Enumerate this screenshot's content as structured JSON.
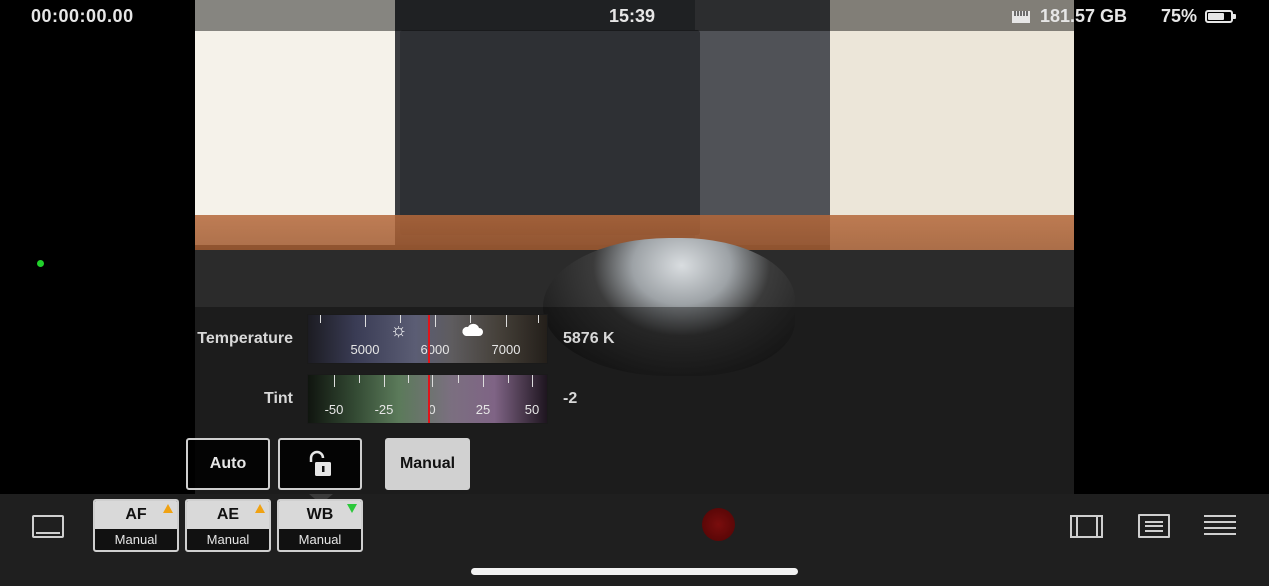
{
  "status_bar": {
    "timecode": "00:00:00.00",
    "clock": "15:39",
    "storage_icon": "sd-card-icon",
    "storage": "181.57 GB",
    "battery": "75%",
    "battery_level_fraction": 0.75
  },
  "preview": {
    "scene": "camera-live-view"
  },
  "white_balance": {
    "temperature_label": "Temperature",
    "temperature_ticks": [
      "5000",
      "6000",
      "7000"
    ],
    "temperature_value": "5876 K",
    "temperature_icons": [
      "sun-icon",
      "cloud-icon"
    ],
    "tint_label": "Tint",
    "tint_ticks": [
      "-50",
      "-25",
      "0",
      "25",
      "50"
    ],
    "tint_value": "-2",
    "buttons": {
      "auto": "Auto",
      "lock_icon": "unlock-icon",
      "manual": "Manual"
    },
    "selected_mode": "Manual"
  },
  "bottom_bar": {
    "pills": [
      {
        "title": "AF",
        "sub": "Manual",
        "flag": "warning",
        "flag_color": "#f0a212"
      },
      {
        "title": "AE",
        "sub": "Manual",
        "flag": "warning",
        "flag_color": "#f0a212"
      },
      {
        "title": "WB",
        "sub": "Manual",
        "flag": "ok",
        "flag_color": "#2cc83b"
      }
    ],
    "icons": [
      "monitor-icon",
      "record-button",
      "filmstrip-icon",
      "adjust-icon",
      "menu-icon"
    ],
    "record_color": "#6e0b0b"
  },
  "colors": {
    "needle": "#e0141a",
    "status_dot": "#21d12b"
  }
}
